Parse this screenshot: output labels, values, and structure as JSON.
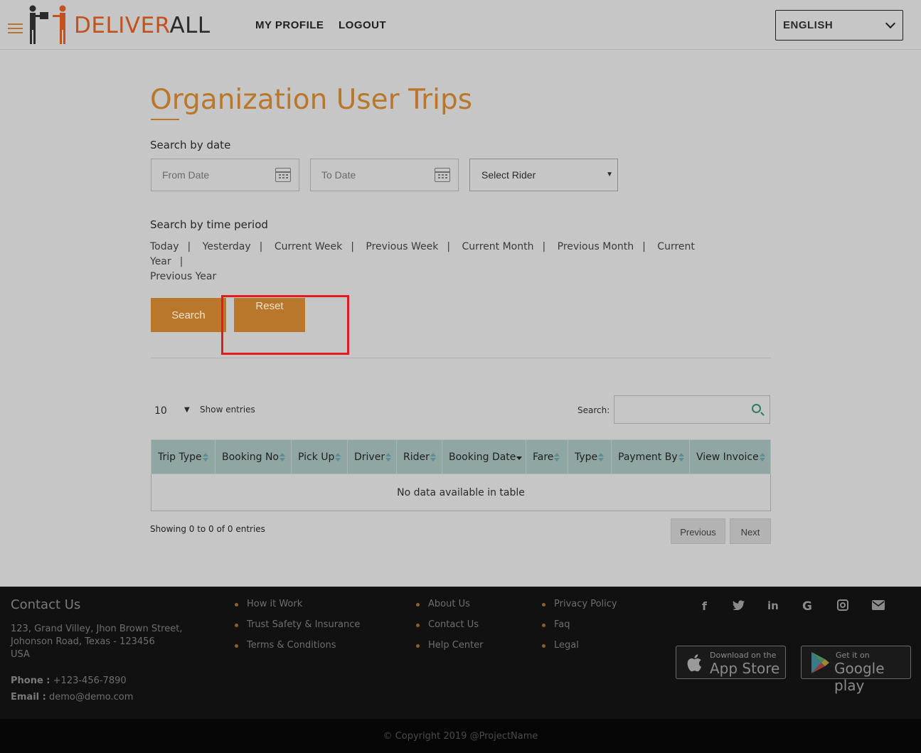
{
  "header": {
    "logo_part1": "DELIVER",
    "logo_part2": "ALL",
    "nav": [
      "MY PROFILE",
      "LOGOUT"
    ],
    "language": "ENGLISH"
  },
  "page": {
    "title": "Organization User Trips",
    "search_by_date_label": "Search by date",
    "from_date_placeholder": "From Date",
    "to_date_placeholder": "To Date",
    "select_rider": "Select Rider",
    "search_by_period_label": "Search by time period",
    "periods": [
      "Today",
      "Yesterday",
      "Current Week",
      "Previous Week",
      "Current Month",
      "Previous Month",
      "Current Year",
      "Previous Year"
    ],
    "search_button": "Search",
    "reset_button": "Reset"
  },
  "table_controls": {
    "entries_value": "10",
    "entries_label": "Show entries",
    "search_label": "Search:"
  },
  "table": {
    "columns": [
      "Trip Type",
      "Booking No",
      "Pick Up",
      "Driver",
      "Rider",
      "Booking Date",
      "Fare",
      "Type",
      "Payment By",
      "View Invoice"
    ],
    "empty_message": "No data available in table",
    "showing": "Showing 0 to 0 of 0 entries",
    "prev": "Previous",
    "next": "Next"
  },
  "footer": {
    "contact_heading": "Contact Us",
    "address_line1": "123, Grand Villey, Jhon Brown Street,",
    "address_line2": "Johonson Road, Texas - 123456",
    "address_line3": "USA",
    "phone_label": "Phone :",
    "phone": "+123-456-7890",
    "email_label": "Email :",
    "email": "demo@demo.com",
    "col1": [
      "How it Work",
      "Trust Safety & Insurance",
      "Terms & Conditions"
    ],
    "col2": [
      "About Us",
      "Contact Us",
      "Help Center"
    ],
    "col3": [
      "Privacy Policy",
      "Faq",
      "Legal"
    ],
    "app_store_small": "Download on the",
    "app_store_big": "App Store",
    "google_small": "Get it on",
    "google_big": "Google play",
    "copyright": "© Copyright 2019 @ProjectName"
  },
  "colors": {
    "accent": "#b8772a",
    "logo_red": "#c2511d",
    "table_header": "#8fa6a3",
    "highlight_box": "#e21c1c"
  }
}
